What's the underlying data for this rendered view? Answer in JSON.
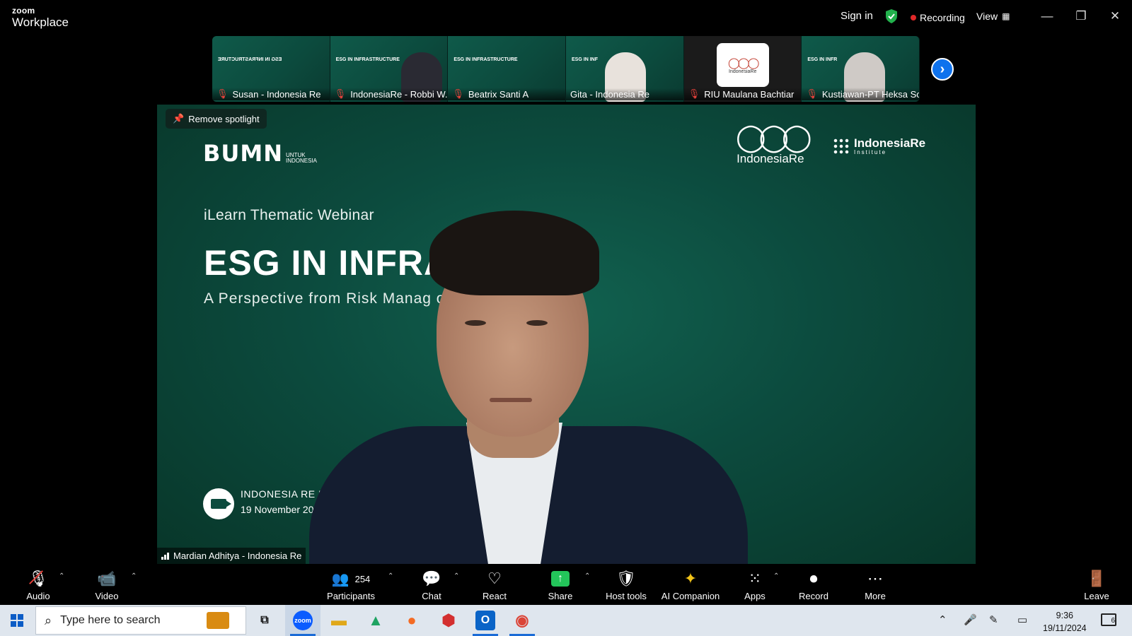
{
  "app": {
    "logo_line1": "zoom",
    "logo_line2": "Workplace"
  },
  "titlebar": {
    "sign_in": "Sign in",
    "recording": "Recording",
    "view": "View"
  },
  "thumbnails": [
    {
      "name": "Susan - Indonesia Re"
    },
    {
      "name": "IndonesiaRe - Robbi W..."
    },
    {
      "name": "Beatrix Santi A"
    },
    {
      "name": "Gita - Indonesia Re"
    },
    {
      "name": "RIU Maulana Bachtiar"
    },
    {
      "name": "Kustiawan-PT Heksa So..."
    }
  ],
  "stage": {
    "remove_spotlight": "Remove spotlight",
    "bumn_big": "BUMN",
    "bumn_small1": "UNTUK",
    "bumn_small2": "INDONESIA",
    "indonesia_re": "IndonesiaRe",
    "institute_name": "IndonesiaRe",
    "institute_sub": "Institute",
    "ilearn": "iLearn Thematic Webinar",
    "title": "ESG IN INFRAS           RE",
    "subtitle": "A Perspective from Risk Manag                                      olution",
    "event_line1": "INDONESIA RE INS",
    "event_line2": "19 November 20",
    "speaker": "Mardian Adhitya - Indonesia Re"
  },
  "toolbar": {
    "audio": "Audio",
    "video": "Video",
    "participants": "Participants",
    "participants_count": "254",
    "chat": "Chat",
    "react": "React",
    "share": "Share",
    "host_tools": "Host tools",
    "ai_companion": "AI Companion",
    "apps": "Apps",
    "record": "Record",
    "more": "More",
    "leave": "Leave"
  },
  "taskbar": {
    "search_placeholder": "Type here to search",
    "time": "9:36",
    "date": "19/11/2024",
    "notif_count": "6"
  },
  "colors": {
    "zoom_blue": "#0e72ed",
    "share_green": "#23c55a",
    "slide_teal": "#0c4b3e",
    "muted_red": "#e4413a"
  }
}
